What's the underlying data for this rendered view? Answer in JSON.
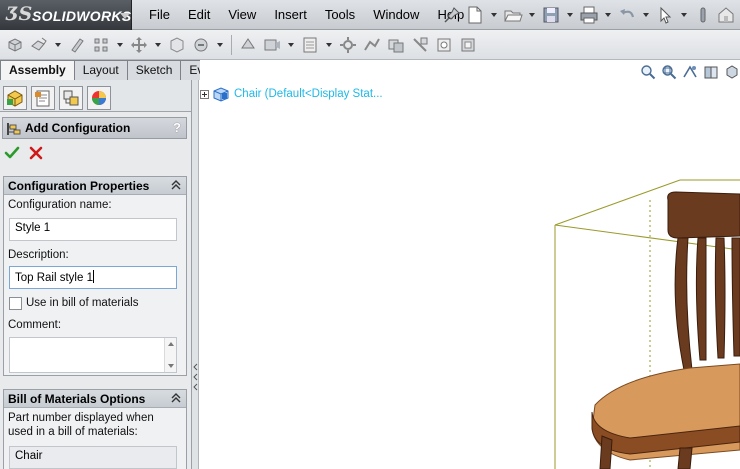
{
  "app": {
    "logo_ds": "ƷS",
    "logo_word": "SOLIDWORKS"
  },
  "menu": [
    "File",
    "Edit",
    "View",
    "Insert",
    "Tools",
    "Window",
    "Help"
  ],
  "tabs": [
    "Assembly",
    "Layout",
    "Sketch",
    "Evaluate"
  ],
  "active_tab": "Assembly",
  "property_manager": {
    "title": "Add Configuration",
    "help": "?",
    "config_props": {
      "header": "Configuration Properties",
      "name_label": "Configuration name:",
      "name_value": "Style 1",
      "desc_label": "Description:",
      "desc_value": "Top Rail style 1",
      "use_bom_label": "Use in bill of materials",
      "use_bom_checked": false,
      "comment_label": "Comment:",
      "comment_value": ""
    },
    "bom_options": {
      "header": "Bill of Materials Options",
      "part_number_label_1": "Part number displayed when",
      "part_number_label_2": "used in a bill of materials:",
      "part_number_value": "Chair"
    }
  },
  "tree": {
    "item_label": "Chair  (Default<Display Stat..."
  },
  "colors": {
    "tree_text": "#1fb8e8",
    "bounding_box": "#9a9a2a",
    "chair_wood": "#6b3b1f",
    "chair_seat": "#d79a5c"
  }
}
